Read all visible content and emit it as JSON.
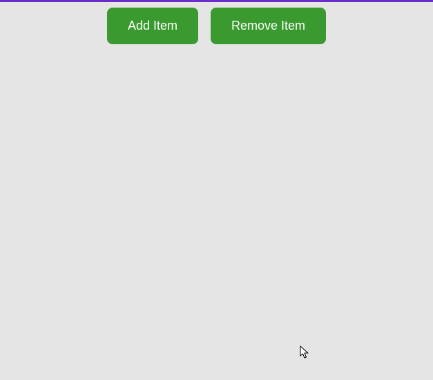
{
  "toolbar": {
    "add_label": "Add Item",
    "remove_label": "Remove Item"
  },
  "colors": {
    "accent_bar": "#6a2fc9",
    "button_bg": "#3a9a2f",
    "button_fg": "#ffffff",
    "page_bg": "#e5e5e5"
  }
}
